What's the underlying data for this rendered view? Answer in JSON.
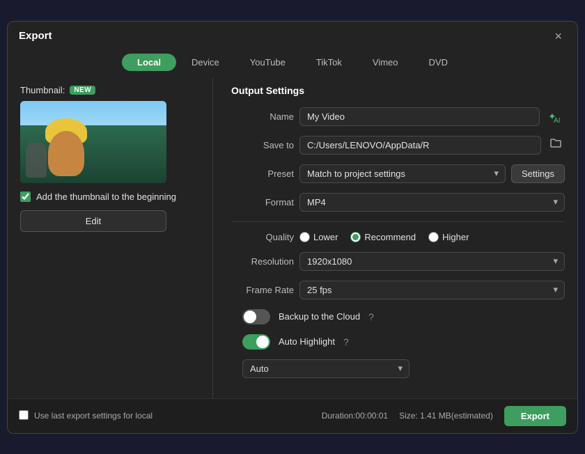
{
  "modal": {
    "title": "Export",
    "close_label": "×"
  },
  "tabs": [
    {
      "id": "local",
      "label": "Local",
      "active": true
    },
    {
      "id": "device",
      "label": "Device",
      "active": false
    },
    {
      "id": "youtube",
      "label": "YouTube",
      "active": false
    },
    {
      "id": "tiktok",
      "label": "TikTok",
      "active": false
    },
    {
      "id": "vimeo",
      "label": "Vimeo",
      "active": false
    },
    {
      "id": "dvd",
      "label": "DVD",
      "active": false
    }
  ],
  "left": {
    "thumbnail_label": "Thumbnail:",
    "new_badge": "NEW",
    "add_thumbnail_label": "Add the thumbnail to the beginning",
    "edit_button_label": "Edit"
  },
  "right": {
    "section_title": "Output Settings",
    "name_label": "Name",
    "name_value": "My Video",
    "save_to_label": "Save to",
    "save_to_value": "C:/Users/LENOVO/AppData/R",
    "preset_label": "Preset",
    "preset_value": "Match to project settings",
    "settings_button_label": "Settings",
    "format_label": "Format",
    "format_value": "MP4",
    "quality_label": "Quality",
    "quality_options": [
      {
        "label": "Lower",
        "value": "lower"
      },
      {
        "label": "Recommend",
        "value": "recommend",
        "checked": true
      },
      {
        "label": "Higher",
        "value": "higher"
      }
    ],
    "resolution_label": "Resolution",
    "resolution_value": "1920x1080",
    "frame_rate_label": "Frame Rate",
    "frame_rate_value": "25 fps",
    "backup_label": "Backup to the Cloud",
    "backup_enabled": false,
    "auto_highlight_label": "Auto Highlight",
    "auto_highlight_enabled": true,
    "auto_value": "Auto"
  },
  "footer": {
    "use_last_settings_label": "Use last export settings for local",
    "duration_label": "Duration:00:00:01",
    "size_label": "Size: 1.41 MB(estimated)",
    "export_button_label": "Export"
  }
}
